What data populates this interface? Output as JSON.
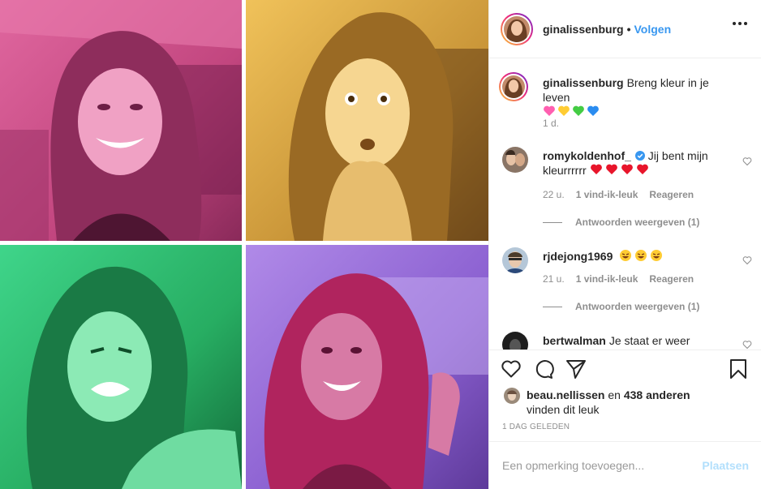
{
  "post": {
    "author": "ginalissenburg",
    "follow_label": "Volgen",
    "separator": "•",
    "caption": {
      "username": "ginalissenburg",
      "text": "Breng kleur in je leven",
      "emojis": [
        "pink-heart",
        "yellow-heart",
        "green-heart",
        "blue-heart"
      ],
      "time": "1 d."
    },
    "photos": [
      {
        "name": "photo-pink",
        "tint": "#d8559a"
      },
      {
        "name": "photo-yellow",
        "tint": "#d8a53c"
      },
      {
        "name": "photo-green",
        "tint": "#2fbf6e"
      },
      {
        "name": "photo-purple",
        "tint": "#8d5ad6"
      }
    ]
  },
  "comments": [
    {
      "username": "romykoldenhof_",
      "verified": true,
      "text": "Jij bent mijn kleurrrrrr",
      "emoji": "red-hearts",
      "time": "22 u.",
      "likes": "1 vind-ik-leuk",
      "reply_label": "Reageren",
      "view_replies": "Antwoorden weergeven (1)"
    },
    {
      "username": "rjdejong1969",
      "verified": false,
      "text": "",
      "emoji": "rolling-laughing-faces",
      "time": "21 u.",
      "likes": "1 vind-ik-leuk",
      "reply_label": "Reageren",
      "view_replies": "Antwoorden weergeven (1)"
    },
    {
      "username": "bertwalman",
      "verified": false,
      "text": "Je staat er weer"
    }
  ],
  "likes": {
    "user": "beau.nellissen",
    "connector": "en",
    "others": "438 anderen",
    "suffix": "vinden dit leuk"
  },
  "timestamp": "1 DAG GELEDEN",
  "add_comment": {
    "placeholder": "Een opmerking toevoegen...",
    "post_label": "Plaatsen"
  },
  "colors": {
    "link_blue": "#3897f0",
    "post_disabled": "#b2dffc",
    "border": "#efefef",
    "muted": "#8e8e8e"
  }
}
